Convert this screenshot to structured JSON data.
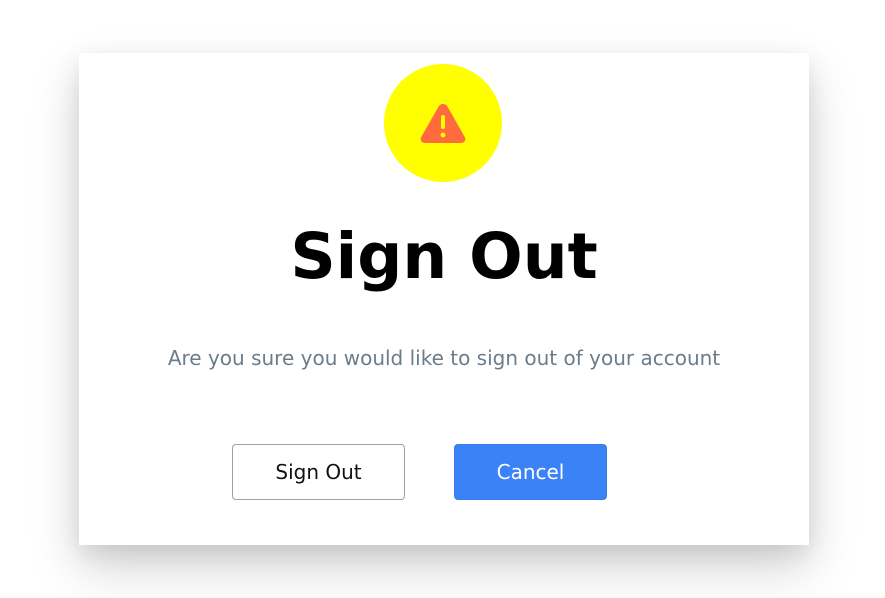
{
  "dialog": {
    "icon": "warning-triangle-icon",
    "title": "Sign Out",
    "message": "Are you sure you would like to sign out of your account",
    "confirm_label": "Sign Out",
    "cancel_label": "Cancel"
  },
  "colors": {
    "icon_circle": "#ffff00",
    "icon_triangle": "#ff6b3d",
    "cancel_bg": "#3b82f6",
    "message_text": "#6b7c8a"
  }
}
